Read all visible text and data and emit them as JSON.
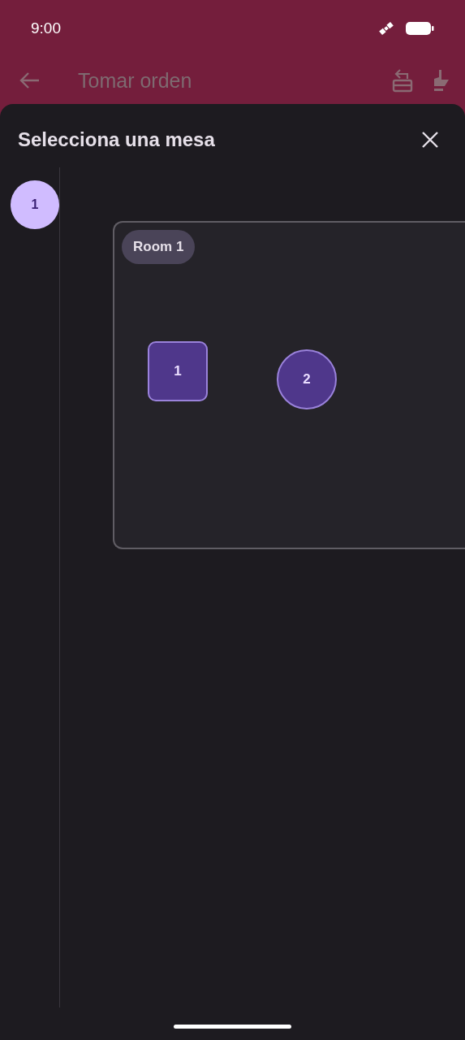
{
  "status_bar": {
    "time": "9:00"
  },
  "app_bar": {
    "title": "Tomar orden"
  },
  "sheet": {
    "title": "Selecciona una mesa"
  },
  "rooms_sidebar": [
    {
      "label": "1",
      "selected": true
    }
  ],
  "room": {
    "label": "Room 1",
    "tables": [
      {
        "label": "1",
        "kind": "square"
      },
      {
        "label": "2",
        "kind": "round"
      }
    ]
  }
}
